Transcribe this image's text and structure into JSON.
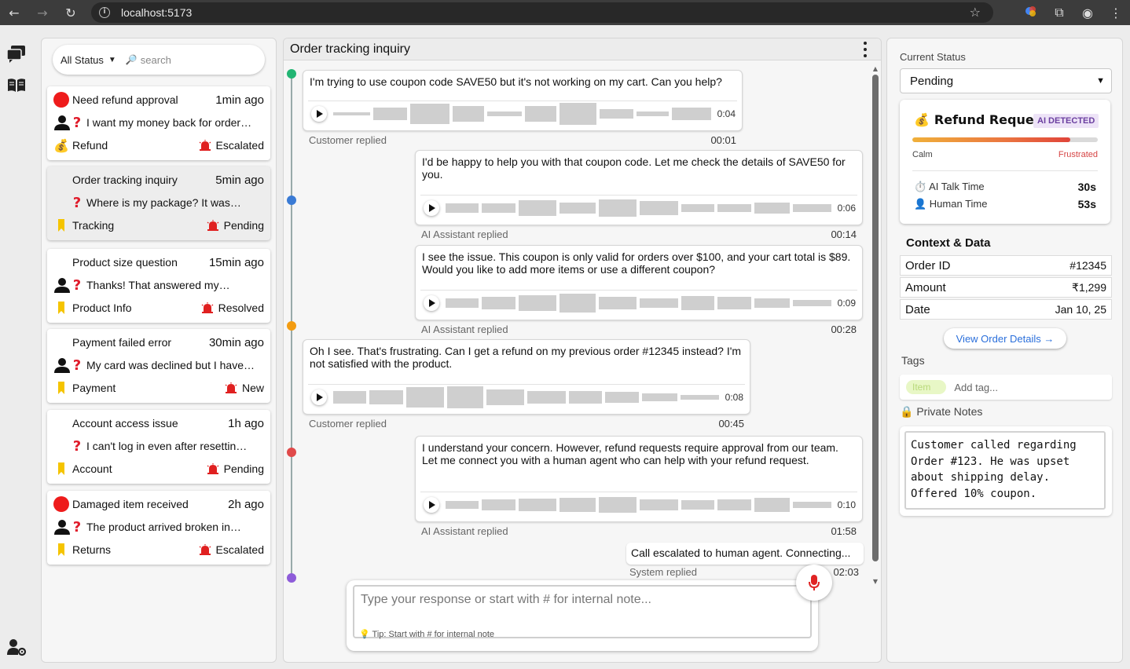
{
  "browser": {
    "url": "localhost:5173"
  },
  "filters": {
    "status": "All Status",
    "search_placeholder": "search"
  },
  "conversations": [
    {
      "title": "Need refund approval",
      "time": "1min ago",
      "preview": "I want my money back for order…",
      "category": "Refund",
      "status": "Escalated",
      "urgent": true,
      "customer": true,
      "category_icon": "moneybag-icon"
    },
    {
      "title": "Order tracking inquiry",
      "time": "5min ago",
      "preview": "Where is my package? It was…",
      "category": "Tracking",
      "status": "Pending",
      "urgent": false,
      "customer": false,
      "category_icon": "bookmark-icon"
    },
    {
      "title": "Product size question",
      "time": "15min ago",
      "preview": "Thanks! That answered my…",
      "category": "Product Info",
      "status": "Resolved",
      "urgent": false,
      "customer": true,
      "category_icon": "bookmark-icon"
    },
    {
      "title": "Payment failed error",
      "time": "30min ago",
      "preview": "My card was declined but I have…",
      "category": "Payment",
      "status": "New",
      "urgent": false,
      "customer": true,
      "category_icon": "bookmark-icon"
    },
    {
      "title": "Account access issue",
      "time": "1h ago",
      "preview": "I can't log in even after resettin…",
      "category": "Account",
      "status": "Pending",
      "urgent": false,
      "customer": false,
      "category_icon": "bookmark-icon"
    },
    {
      "title": "Damaged item received",
      "time": "2h ago",
      "preview": "The product arrived broken in…",
      "category": "Returns",
      "status": "Escalated",
      "urgent": true,
      "customer": true,
      "category_icon": "bookmark-icon"
    }
  ],
  "chat": {
    "title": "Order tracking inquiry",
    "messages": [
      {
        "text": "I'm trying to use coupon code SAVE50 but it's not working on my cart. Can you help?",
        "duration": "0:04",
        "sender": "Customer replied",
        "timestamp": "00:01"
      },
      {
        "text": "I'd be happy to help you with that coupon code. Let me check the details of SAVE50 for you.",
        "duration": "0:06",
        "sender": "AI Assistant replied",
        "timestamp": "00:14"
      },
      {
        "text": "I see the issue. This coupon is only valid for orders over $100, and your cart total is $89. Would you like to add more items or use a different coupon?",
        "duration": "0:09",
        "sender": "AI Assistant replied",
        "timestamp": "00:28"
      },
      {
        "text": "Oh I see. That's frustrating. Can I get a refund on my previous order #12345 instead? I'm not satisfied with the product.",
        "duration": "0:08",
        "sender": "Customer replied",
        "timestamp": "00:45"
      },
      {
        "text": "I understand your concern. However, refund requests require approval from our team. Let me connect you with a human agent who can help with your refund request.",
        "duration": "0:10",
        "sender": "AI Assistant replied",
        "timestamp": "01:58"
      },
      {
        "text": "Call escalated to human agent. Connecting...",
        "sender": "System replied",
        "timestamp": "02:03"
      }
    ],
    "composer_placeholder": "Type your response or start with # for internal note...",
    "composer_tip": "💡 Tip: Start with # for internal note"
  },
  "details": {
    "current_status_label": "Current Status",
    "current_status": "Pending",
    "intent_title": "Refund Request",
    "intent_emoji": "💰",
    "ai_badge": "AI DETECTED",
    "sentiment": 0.85,
    "sentiment_low": "Calm",
    "sentiment_high": "Frustrated",
    "ai_talk_label": "⏱️ AI Talk Time",
    "ai_talk_value": "30s",
    "human_time_label": "👤 Human Time",
    "human_time_value": "53s",
    "context_title": "Context & Data",
    "order_id_label": "Order ID",
    "order_id": "#12345",
    "amount_label": "Amount",
    "amount": "₹1,299",
    "date_label": "Date",
    "date": "Jan 10, 25",
    "view_order": "View Order Details →",
    "tags_label": "Tags",
    "tag": "Item",
    "tag_placeholder": "Add tag...",
    "notes_label": "🔒 Private Notes",
    "notes": "Customer called regarding Order #123. He was upset about shipping delay. Offered 10% coupon."
  },
  "colors": {
    "accent_blue": "#2a6fdb",
    "urgent_red": "#ee1b1b",
    "category_yellow": "#f5c400",
    "timeline": [
      "#22b573",
      "#3a7bd5",
      "#f39c12",
      "#e04a4a",
      "#8e5cd9"
    ]
  }
}
